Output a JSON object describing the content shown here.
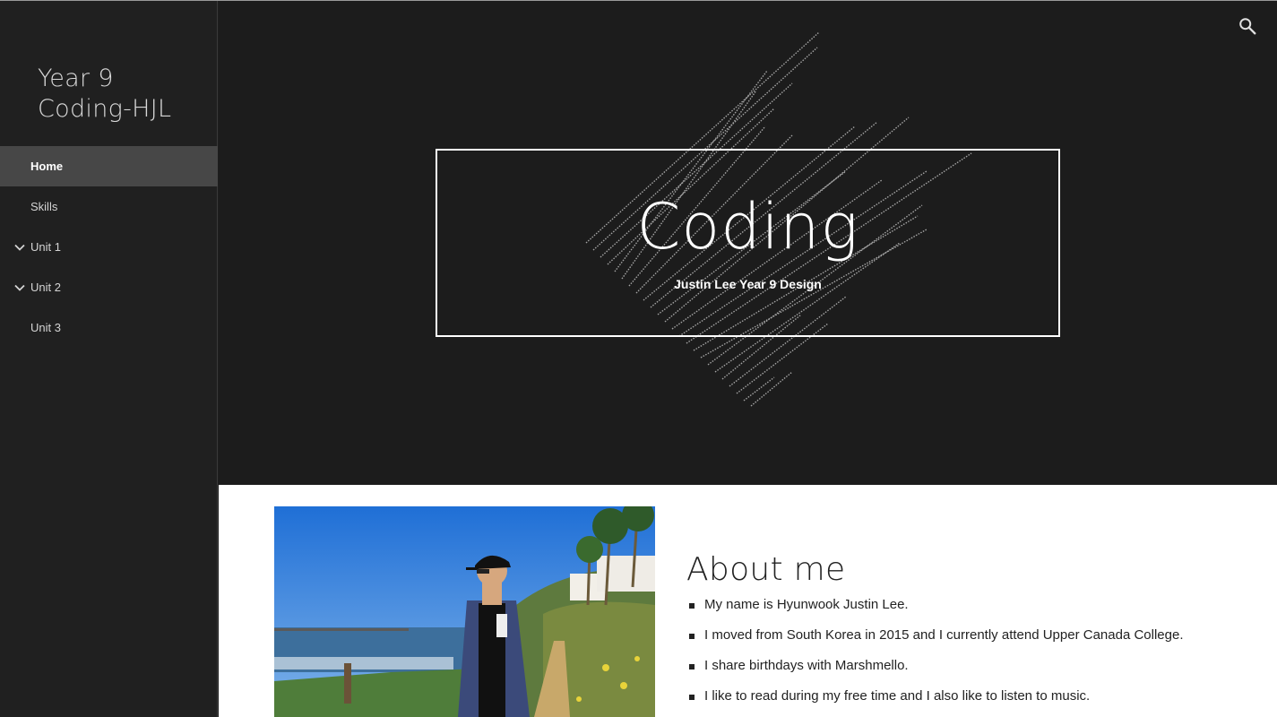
{
  "site": {
    "title": "Year 9 Coding-HJL"
  },
  "nav": {
    "items": [
      {
        "label": "Home",
        "active": true,
        "expandable": false
      },
      {
        "label": "Skills",
        "active": false,
        "expandable": false
      },
      {
        "label": "Unit 1",
        "active": false,
        "expandable": true
      },
      {
        "label": "Unit 2",
        "active": false,
        "expandable": true
      },
      {
        "label": "Unit 3",
        "active": false,
        "expandable": false
      }
    ]
  },
  "header": {
    "search_icon": "search-icon"
  },
  "hero": {
    "title": "Coding",
    "subtitle": "Justin Lee Year 9 Design",
    "background_color": "#1c1c1c"
  },
  "about": {
    "heading": "About me",
    "items": [
      "My name is Hyunwook Justin Lee.",
      "I moved from South Korea in 2015 and I currently attend Upper Canada College.",
      "I share birthdays with Marshmello.",
      "I like to read during my free time and I also like to listen to music."
    ]
  },
  "colors": {
    "sidebar": "#202020",
    "active_nav": "#474747",
    "content_bg": "#ffffff"
  }
}
